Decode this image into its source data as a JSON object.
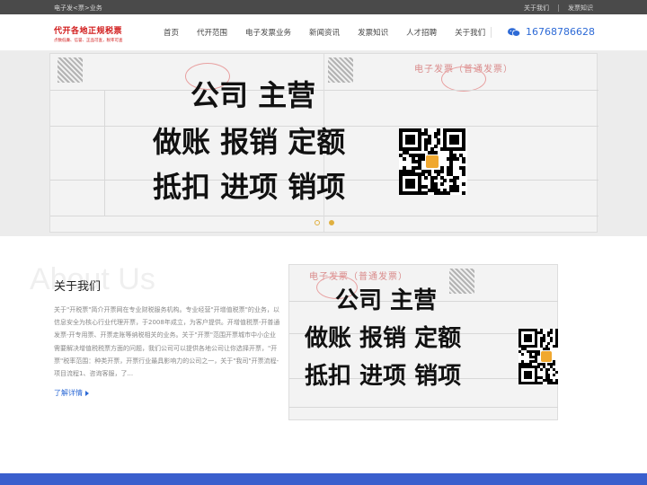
{
  "topbar": {
    "breadcrumb": "电子发<票>业务",
    "links": [
      "关于我们",
      "发票知识"
    ]
  },
  "logo": {
    "title": "代开各地正规税票",
    "slogan": "点数低廉、信誉、正品可查，税率可查"
  },
  "nav": {
    "items": [
      "首页",
      "代开范围",
      "电子发票业务",
      "新闻资讯",
      "发票知识",
      "人才招聘",
      "关于我们"
    ]
  },
  "contact": {
    "phone": "16768786628",
    "icon": "wechat-icon"
  },
  "banner": {
    "line1": "公司  主营",
    "line2": "做账  报销  定额",
    "line3": "抵扣  进项  销项",
    "invoice_title": "电子发票（普通发票）",
    "slides": 2,
    "active_slide": 2
  },
  "about": {
    "bg_text": "About Us",
    "title": "关于我们",
    "body": "关于\"开税票\"简介开票网在专业财税服务机构。专业经营\"开增值税票\"的业务，以信息安全为核心行业代理开票，于2008年成立，为客户提供。开增值税票-开普通发票-开专用票、开票走账等纳税相关的业务。关于\"开票\"范围开票城市中小企业需要解决增值税税票方面的问题，我们公司可以提供各地公司让你选择开票，\"开票\"税率范围：种类开票，开票行业最具影响力的公司之一，关于\"我司\"开票流程-项目流程1、咨询客服，了...",
    "more_label": "了解详情"
  },
  "colors": {
    "accent": "#2d6ad6",
    "brand_red": "#d11a1a",
    "footer": "#3a5fcd",
    "dot": "#e0b040"
  }
}
